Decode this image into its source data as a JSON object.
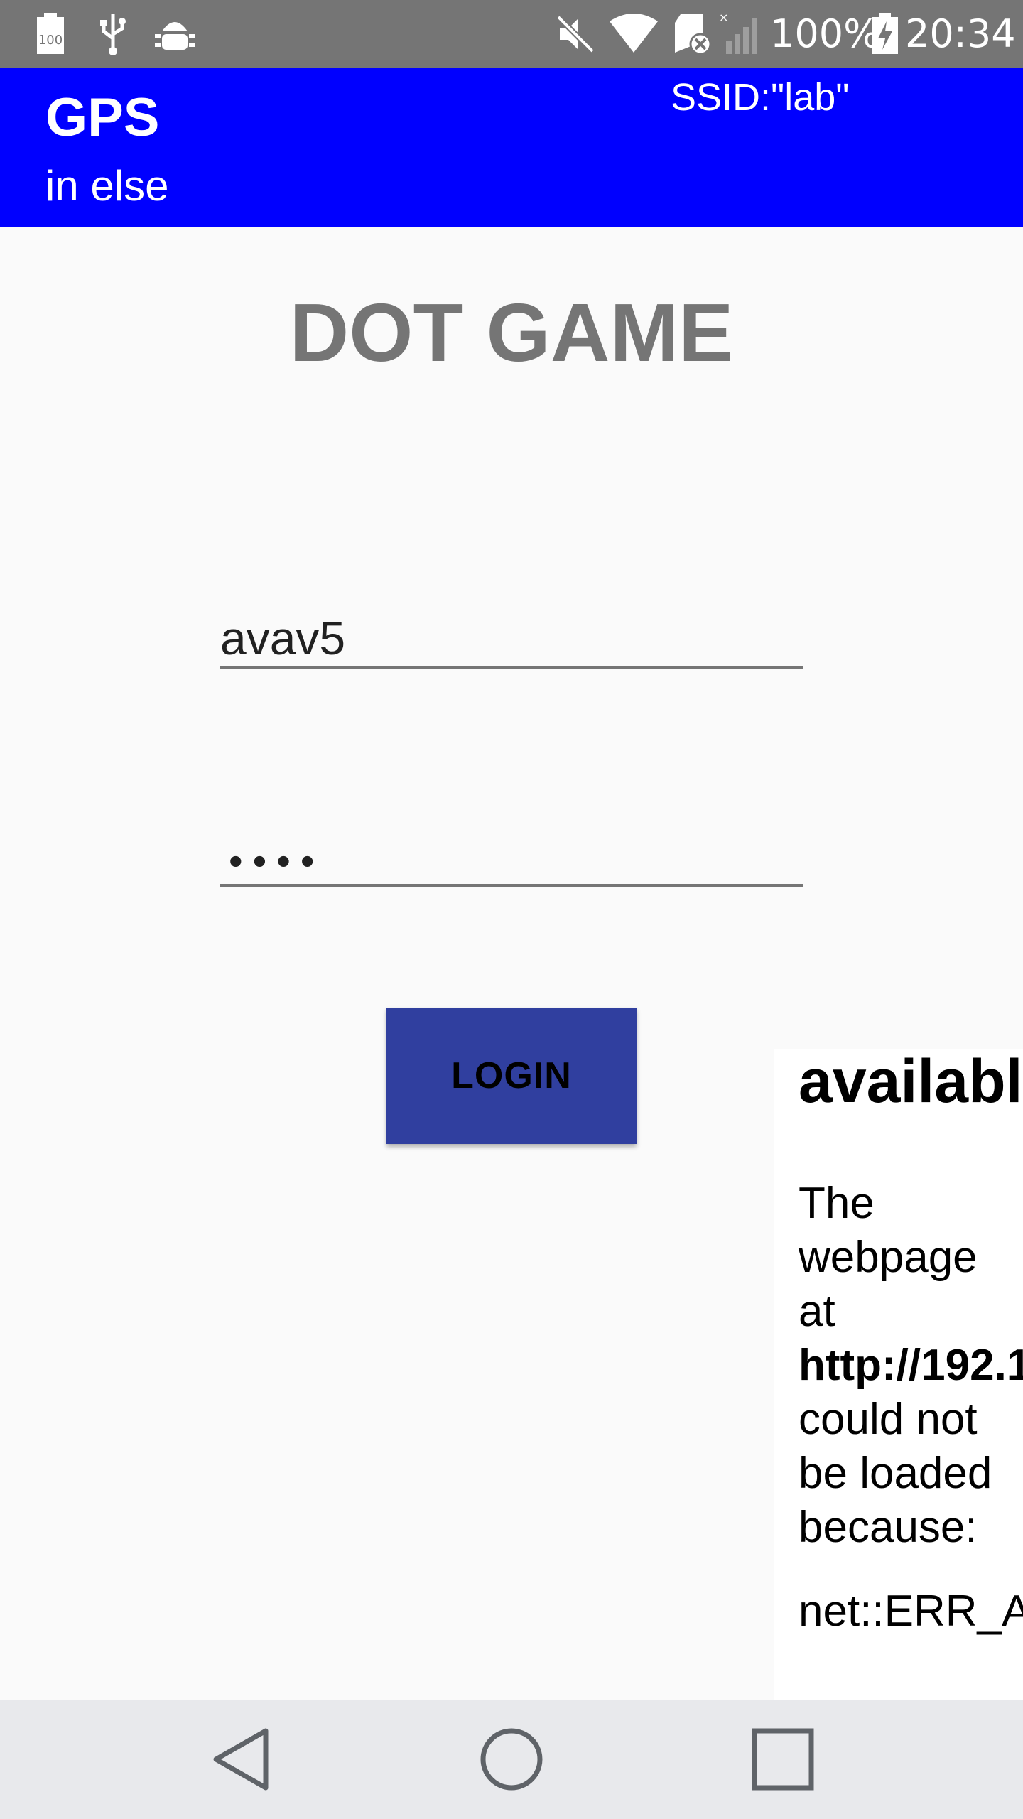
{
  "status_bar": {
    "icons_left": [
      "battery-100-icon",
      "usb-icon",
      "android-debug-icon"
    ],
    "icons_right": [
      "mute-icon",
      "wifi-icon",
      "sd-card-icon",
      "signal-no-service-icon",
      "battery-charging-icon"
    ],
    "battery_text": "100%",
    "time": "20:34"
  },
  "app_bar": {
    "title": "GPS",
    "subtitle": "in else",
    "ssid": "SSID:\"lab\""
  },
  "main": {
    "game_title": "DOT GAME",
    "username_value": "avav5",
    "password_mask": "••••",
    "login_label": "LOGIN"
  },
  "web_error": {
    "heading": "availabl",
    "body_intro": "The webpage at",
    "url": "http://192.1",
    "body_rest": "could not be loaded because:",
    "error_code": "net::ERR_AI"
  },
  "nav_bar": {
    "buttons": [
      "back-icon",
      "home-icon",
      "recents-icon"
    ]
  },
  "colors": {
    "status_bar": "#757575",
    "app_bar": "#0000ff",
    "login_button": "#303f9f",
    "title_gray": "#757575",
    "background": "#fafafa",
    "nav_bar": "#e8e9ec"
  }
}
